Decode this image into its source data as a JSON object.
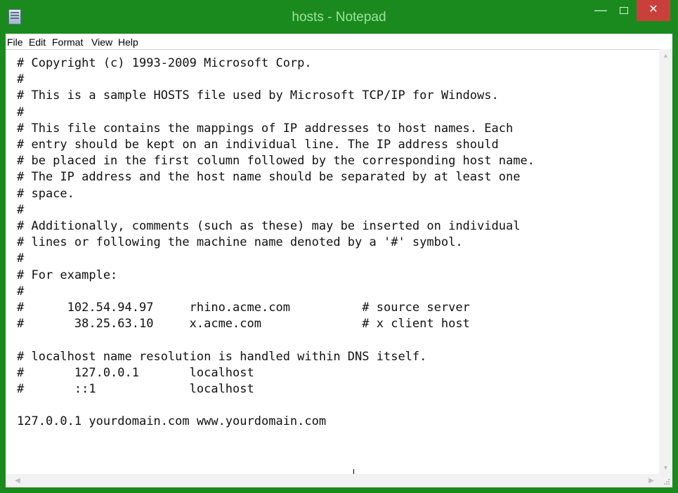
{
  "window": {
    "title": "hosts - Notepad",
    "accent_color": "#1a8a1f",
    "close_color": "#c9403a",
    "app_icon": "notepad-icon"
  },
  "controls": {
    "minimize": "—",
    "close": "✕"
  },
  "menu": {
    "file": "File",
    "edit": "Edit",
    "format": "Format",
    "view": "View",
    "help": "Help"
  },
  "editor": {
    "content": "# Copyright (c) 1993-2009 Microsoft Corp.\n#\n# This is a sample HOSTS file used by Microsoft TCP/IP for Windows.\n#\n# This file contains the mappings of IP addresses to host names. Each\n# entry should be kept on an individual line. The IP address should\n# be placed in the first column followed by the corresponding host name.\n# The IP address and the host name should be separated by at least one\n# space.\n#\n# Additionally, comments (such as these) may be inserted on individual\n# lines or following the machine name denoted by a '#' symbol.\n#\n# For example:\n#\n#      102.54.94.97     rhino.acme.com          # source server\n#       38.25.63.10     x.acme.com              # x client host\n\n# localhost name resolution is handled within DNS itself.\n#       127.0.0.1       localhost\n#       ::1             localhost\n\n127.0.0.1 yourdomain.com www.yourdomain.com",
    "annotation_color": "#d7282b"
  }
}
